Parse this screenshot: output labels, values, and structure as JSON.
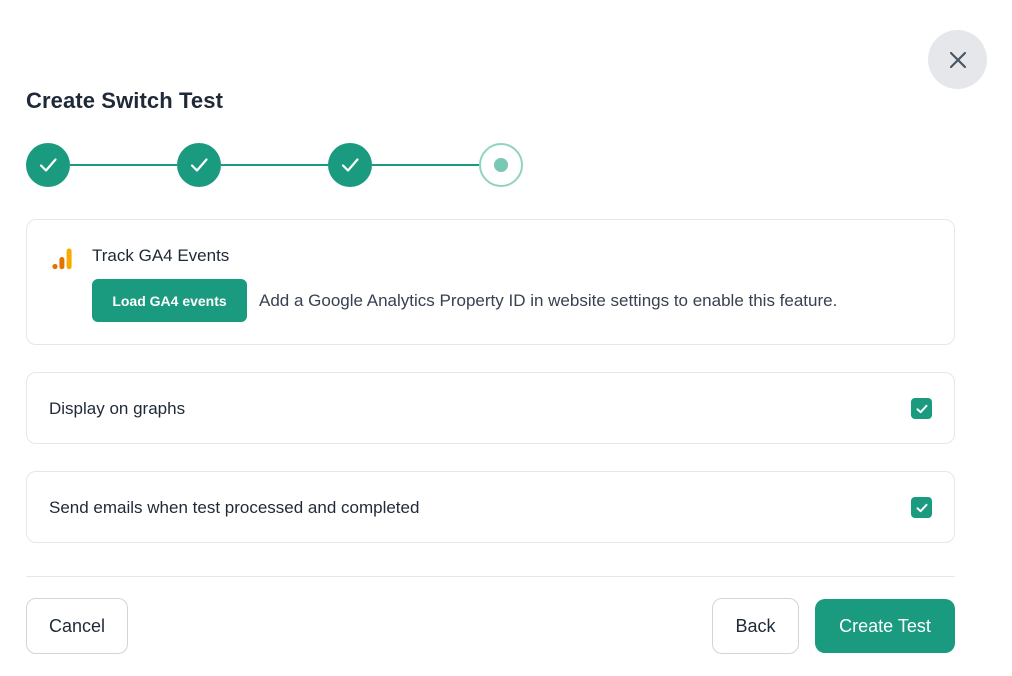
{
  "modal": {
    "title": "Create Switch Test",
    "close_icon": "close-icon"
  },
  "stepper": {
    "steps": [
      {
        "state": "completed",
        "icon": "check-icon"
      },
      {
        "state": "completed",
        "icon": "check-icon"
      },
      {
        "state": "completed",
        "icon": "check-icon"
      },
      {
        "state": "current",
        "icon": "dot-icon"
      }
    ]
  },
  "ga4": {
    "icon": "analytics-bars-icon",
    "title": "Track GA4 Events",
    "load_button": "Load GA4 events",
    "help_text": "Add a Google Analytics Property ID in website settings to enable this feature."
  },
  "options": {
    "display_on_graphs": {
      "label": "Display on graphs",
      "checked": true
    },
    "send_emails": {
      "label": "Send emails when test processed and completed",
      "checked": true
    }
  },
  "footer": {
    "cancel_label": "Cancel",
    "back_label": "Back",
    "create_label": "Create Test"
  },
  "colors": {
    "accent": "#1a9a7e",
    "accent_light": "#8fd3c2",
    "ga4_orange": "#f59e0b",
    "ga4_dark_orange": "#e37400"
  }
}
